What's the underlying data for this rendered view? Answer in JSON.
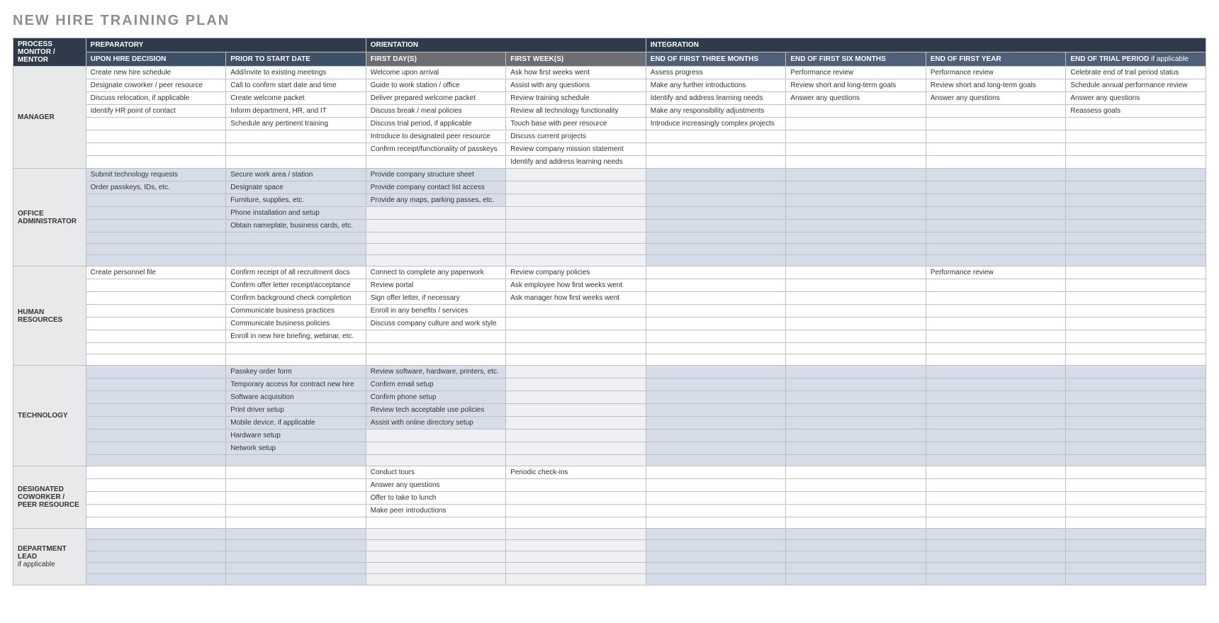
{
  "title": "NEW HIRE TRAINING PLAN",
  "headers": {
    "mentor": "PROCESS MONITOR / MENTOR",
    "preparatory": "PREPARATORY",
    "orientation": "ORIENTATION",
    "integration": "INTEGRATION",
    "upon_hire": "UPON HIRE DECISION",
    "prior_start": "PRIOR TO START DATE",
    "first_days": "FIRST DAY(S)",
    "first_weeks": "FIRST WEEK(S)",
    "end_3m": "END OF FIRST THREE MONTHS",
    "end_6m": "END OF FIRST SIX MONTHS",
    "end_1y": "END OF FIRST YEAR",
    "end_trial": "END OF TRIAL PERIOD",
    "end_trial_suffix": " if applicable"
  },
  "roles": {
    "manager": "MANAGER",
    "office_admin": "OFFICE ADMINISTRATOR",
    "hr": "HUMAN RESOURCES",
    "technology": "TECHNOLOGY",
    "designated": "DESIGNATED COWORKER / PEER RESOURCE",
    "dept_lead": "DEPARTMENT LEAD",
    "dept_lead_suffix": "if applicable"
  },
  "sections": {
    "manager": [
      [
        "Create new hire schedule",
        "Add/invite to existing meetings",
        "Welcome upon arrival",
        "Ask how first weeks went",
        "Assess progress",
        "Performance review",
        "Performance review",
        "Celebrate end of trail period status"
      ],
      [
        "Designate coworker / peer resource",
        "Call to confirm start date and time",
        "Guide to work station / office",
        "Assist with any questions",
        "Make any further introductions",
        "Review short and long-term goals",
        "Review short and long-term goals",
        "Schedule annual performance review"
      ],
      [
        "Discuss relocation, if applicable",
        "Create welcome packet",
        "Deliver prepared welcome packet",
        "Review training schedule",
        "Identify and address learning needs",
        "Answer any questions",
        "Answer any questions",
        "Answer any questions"
      ],
      [
        "Identify HR point of contact",
        "Inform department, HR, and IT",
        "Discuss break / meal policies",
        "Review all technology functionality",
        "Make any responsibility adjustments",
        "",
        "",
        "Reassess goals"
      ],
      [
        "",
        "Schedule any pertinent training",
        "Discuss trial period, if applicable",
        "Touch base with peer resource",
        "Introduce increasingly complex projects",
        "",
        "",
        ""
      ],
      [
        "",
        "",
        "Introduce to designated peer resource",
        "Discuss current projects",
        "",
        "",
        "",
        ""
      ],
      [
        "",
        "",
        "Confirm receipt/functionality of passkeys",
        "Review company mission statement",
        "",
        "",
        "",
        ""
      ],
      [
        "",
        "",
        "",
        "Identify and address learning needs",
        "",
        "",
        "",
        ""
      ]
    ],
    "office_admin": [
      [
        "Submit technology requests",
        "Secure work area / station",
        "Provide company structure sheet",
        "",
        "",
        "",
        "",
        ""
      ],
      [
        "Order passkeys, IDs, etc.",
        "Designate space",
        "Provide company contact list access",
        "",
        "",
        "",
        "",
        ""
      ],
      [
        "",
        "Furniture, supplies, etc.",
        "Provide any maps, parking passes, etc.",
        "",
        "",
        "",
        "",
        ""
      ],
      [
        "",
        "Phone installation and setup",
        "",
        "",
        "",
        "",
        "",
        ""
      ],
      [
        "",
        "Obtain nameplate, business cards, etc.",
        "",
        "",
        "",
        "",
        "",
        ""
      ],
      [
        "",
        "",
        "",
        "",
        "",
        "",
        "",
        ""
      ],
      [
        "",
        "",
        "",
        "",
        "",
        "",
        "",
        ""
      ],
      [
        "",
        "",
        "",
        "",
        "",
        "",
        "",
        ""
      ]
    ],
    "hr": [
      [
        "Create personnel file",
        "Confirm receipt of all recruitment docs",
        "Connect to complete any paperwork",
        "Review company policies",
        "",
        "",
        "Performance review",
        ""
      ],
      [
        "",
        "Confirm offer letter receipt/acceptance",
        "Review portal",
        "Ask employee how first weeks went",
        "",
        "",
        "",
        ""
      ],
      [
        "",
        "Confirm background check completion",
        "Sign offer letter, if necessary",
        "Ask manager how first weeks went",
        "",
        "",
        "",
        ""
      ],
      [
        "",
        "Communicate business practices",
        "Enroll in any benefits / services",
        "",
        "",
        "",
        "",
        ""
      ],
      [
        "",
        "Communicate business policies",
        "Discuss company culture and work style",
        "",
        "",
        "",
        "",
        ""
      ],
      [
        "",
        "Enroll in new hire briefing, webinar, etc.",
        "",
        "",
        "",
        "",
        "",
        ""
      ],
      [
        "",
        "",
        "",
        "",
        "",
        "",
        "",
        ""
      ],
      [
        "",
        "",
        "",
        "",
        "",
        "",
        "",
        ""
      ]
    ],
    "technology": [
      [
        "",
        "Passkey order form",
        "Review software, hardware, printers, etc.",
        "",
        "",
        "",
        "",
        ""
      ],
      [
        "",
        "Temporary access for contract new hire",
        "Confirm email setup",
        "",
        "",
        "",
        "",
        ""
      ],
      [
        "",
        "Software acquisition",
        "Confirm phone setup",
        "",
        "",
        "",
        "",
        ""
      ],
      [
        "",
        "Print driver setup",
        "Review tech acceptable use policies",
        "",
        "",
        "",
        "",
        ""
      ],
      [
        "",
        "Mobile device, if applicable",
        "Assist with online directory setup",
        "",
        "",
        "",
        "",
        ""
      ],
      [
        "",
        "Hardware setup",
        "",
        "",
        "",
        "",
        "",
        ""
      ],
      [
        "",
        "Network setup",
        "",
        "",
        "",
        "",
        "",
        ""
      ],
      [
        "",
        "",
        "",
        "",
        "",
        "",
        "",
        ""
      ]
    ],
    "designated": [
      [
        "",
        "",
        "Conduct tours",
        "Periodic check-ins",
        "",
        "",
        "",
        ""
      ],
      [
        "",
        "",
        "Answer any questions",
        "",
        "",
        "",
        "",
        ""
      ],
      [
        "",
        "",
        "Offer to take to lunch",
        "",
        "",
        "",
        "",
        ""
      ],
      [
        "",
        "",
        "Make peer introductions",
        "",
        "",
        "",
        "",
        ""
      ],
      [
        "",
        "",
        "",
        "",
        "",
        "",
        "",
        ""
      ]
    ],
    "dept_lead": [
      [
        "",
        "",
        "",
        "",
        "",
        "",
        "",
        ""
      ],
      [
        "",
        "",
        "",
        "",
        "",
        "",
        "",
        ""
      ],
      [
        "",
        "",
        "",
        "",
        "",
        "",
        "",
        ""
      ],
      [
        "",
        "",
        "",
        "",
        "",
        "",
        "",
        ""
      ],
      [
        "",
        "",
        "",
        "",
        "",
        "",
        "",
        ""
      ]
    ]
  },
  "shading": {
    "manager": [
      [
        0,
        0,
        0,
        0,
        0,
        0,
        0,
        0
      ],
      [
        0,
        0,
        0,
        0,
        0,
        0,
        0,
        0
      ],
      [
        0,
        0,
        0,
        0,
        0,
        0,
        0,
        0
      ],
      [
        0,
        0,
        0,
        0,
        0,
        0,
        0,
        0
      ],
      [
        0,
        0,
        0,
        0,
        0,
        0,
        0,
        0
      ],
      [
        0,
        0,
        0,
        0,
        0,
        0,
        0,
        0
      ],
      [
        0,
        0,
        0,
        0,
        0,
        0,
        0,
        0
      ],
      [
        0,
        0,
        0,
        0,
        0,
        0,
        0,
        0
      ]
    ],
    "office_admin": [
      [
        1,
        1,
        1,
        2,
        1,
        1,
        1,
        1
      ],
      [
        1,
        1,
        1,
        2,
        1,
        1,
        1,
        1
      ],
      [
        1,
        1,
        1,
        2,
        1,
        1,
        1,
        1
      ],
      [
        1,
        1,
        2,
        2,
        1,
        1,
        1,
        1
      ],
      [
        1,
        1,
        2,
        2,
        1,
        1,
        1,
        1
      ],
      [
        1,
        1,
        2,
        2,
        1,
        1,
        1,
        1
      ],
      [
        1,
        1,
        2,
        2,
        1,
        1,
        1,
        1
      ],
      [
        1,
        1,
        2,
        2,
        1,
        1,
        1,
        1
      ]
    ],
    "hr": [
      [
        0,
        0,
        0,
        0,
        0,
        0,
        0,
        0
      ],
      [
        0,
        0,
        0,
        0,
        0,
        0,
        0,
        0
      ],
      [
        0,
        0,
        0,
        0,
        0,
        0,
        0,
        0
      ],
      [
        0,
        0,
        0,
        0,
        0,
        0,
        0,
        0
      ],
      [
        0,
        0,
        0,
        0,
        0,
        0,
        0,
        0
      ],
      [
        0,
        0,
        0,
        0,
        0,
        0,
        0,
        0
      ],
      [
        0,
        0,
        0,
        0,
        0,
        0,
        0,
        0
      ],
      [
        0,
        0,
        0,
        0,
        0,
        0,
        0,
        0
      ]
    ],
    "technology": [
      [
        1,
        1,
        1,
        2,
        1,
        1,
        1,
        1
      ],
      [
        1,
        1,
        1,
        2,
        1,
        1,
        1,
        1
      ],
      [
        1,
        1,
        1,
        2,
        1,
        1,
        1,
        1
      ],
      [
        1,
        1,
        1,
        2,
        1,
        1,
        1,
        1
      ],
      [
        1,
        1,
        1,
        2,
        1,
        1,
        1,
        1
      ],
      [
        1,
        1,
        2,
        2,
        1,
        1,
        1,
        1
      ],
      [
        1,
        1,
        2,
        2,
        1,
        1,
        1,
        1
      ],
      [
        1,
        1,
        2,
        2,
        1,
        1,
        1,
        1
      ]
    ],
    "designated": [
      [
        0,
        0,
        0,
        0,
        0,
        0,
        0,
        0
      ],
      [
        0,
        0,
        0,
        0,
        0,
        0,
        0,
        0
      ],
      [
        0,
        0,
        0,
        0,
        0,
        0,
        0,
        0
      ],
      [
        0,
        0,
        0,
        0,
        0,
        0,
        0,
        0
      ],
      [
        0,
        0,
        0,
        0,
        0,
        0,
        0,
        0
      ]
    ],
    "dept_lead": [
      [
        1,
        1,
        2,
        2,
        1,
        1,
        1,
        1
      ],
      [
        1,
        1,
        2,
        2,
        1,
        1,
        1,
        1
      ],
      [
        1,
        1,
        2,
        2,
        1,
        1,
        1,
        1
      ],
      [
        1,
        1,
        2,
        2,
        1,
        1,
        1,
        1
      ],
      [
        1,
        1,
        2,
        2,
        1,
        1,
        1,
        1
      ]
    ]
  }
}
